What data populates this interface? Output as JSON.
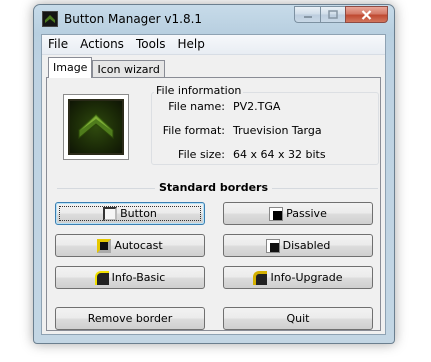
{
  "window": {
    "title": "Button Manager v1.8.1"
  },
  "menu": [
    "File",
    "Actions",
    "Tools",
    "Help"
  ],
  "tabs": [
    "Image",
    "Icon wizard"
  ],
  "file_info": {
    "group_label": "File information",
    "name_label": "File name:",
    "name_value": "PV2.TGA",
    "format_label": "File format:",
    "format_value": "Truevision Targa",
    "size_label": "File size:",
    "size_value": "64 x 64 x 32 bits"
  },
  "borders": {
    "title": "Standard borders",
    "button": "Button",
    "passive": "Passive",
    "autocast": "Autocast",
    "disabled": "Disabled",
    "info_basic": "Info-Basic",
    "info_upgrade": "Info-Upgrade"
  },
  "actions": {
    "remove": "Remove border",
    "quit": "Quit"
  },
  "icons": {
    "app": "chevron-rank-icon",
    "minimize": "minimize-icon",
    "maximize": "maximize-icon",
    "close": "close-icon"
  }
}
